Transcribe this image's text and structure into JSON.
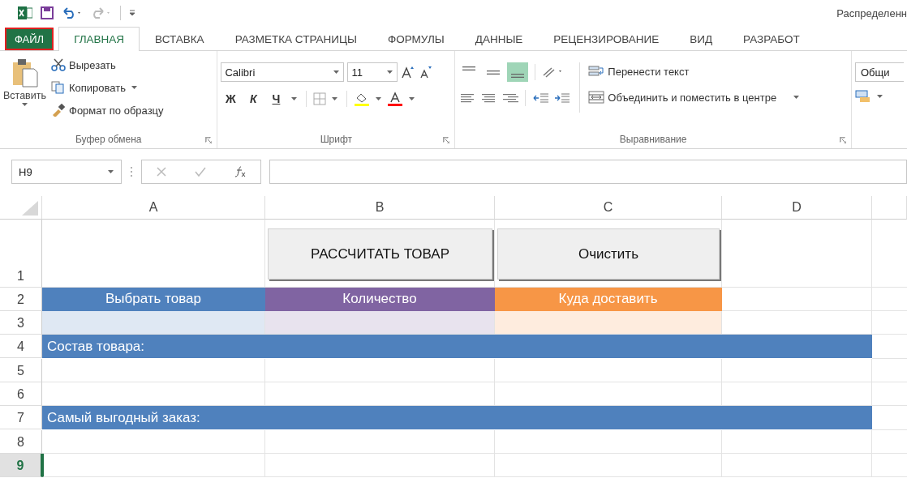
{
  "title_bar": {
    "title": "Распределенн"
  },
  "tabs": [
    {
      "label": "ФАЙЛ",
      "kind": "file",
      "selected": false
    },
    {
      "label": "ГЛАВНАЯ",
      "kind": "tab",
      "selected": true
    },
    {
      "label": "ВСТАВКА",
      "kind": "tab",
      "selected": false
    },
    {
      "label": "РАЗМЕТКА СТРАНИЦЫ",
      "kind": "tab",
      "selected": false
    },
    {
      "label": "ФОРМУЛЫ",
      "kind": "tab",
      "selected": false
    },
    {
      "label": "ДАННЫЕ",
      "kind": "tab",
      "selected": false
    },
    {
      "label": "РЕЦЕНЗИРОВАНИЕ",
      "kind": "tab",
      "selected": false
    },
    {
      "label": "ВИД",
      "kind": "tab",
      "selected": false
    },
    {
      "label": "РАЗРАБОТ",
      "kind": "tab",
      "selected": false
    }
  ],
  "clipboard": {
    "paste": "Вставить",
    "cut": "Вырезать",
    "copy": "Копировать",
    "format_painter": "Формат по образцу",
    "label": "Буфер обмена"
  },
  "font": {
    "font_name": "Calibri",
    "font_size": "11",
    "bold": "Ж",
    "italic": "К",
    "underline": "Ч",
    "label": "Шрифт"
  },
  "alignment": {
    "vertical": [
      {
        "selected": false
      },
      {
        "selected": false
      },
      {
        "selected": true
      }
    ],
    "wrap_text": "Перенести текст",
    "merge_center": "Объединить и поместить в центре",
    "label": "Выравнивание"
  },
  "number": {
    "format": "Общи"
  },
  "formula_bar": {
    "name_box": "H9"
  },
  "columns": [
    "A",
    "B",
    "C",
    "D"
  ],
  "rows": [
    {
      "number": "1",
      "selected": false,
      "kind": "buttons",
      "buttons": [
        "РАССЧИТАТЬ ТОВАР",
        "Очистить"
      ]
    },
    {
      "number": "2",
      "selected": false,
      "kind": "headers",
      "cells": [
        {
          "text": "Выбрать товар",
          "color": "#4f81bd"
        },
        {
          "text": "Количество",
          "color": "#8064a2"
        },
        {
          "text": "Куда доставить",
          "color": "#f79646"
        }
      ]
    },
    {
      "number": "3",
      "selected": false,
      "kind": "inputs"
    },
    {
      "number": "4",
      "selected": false,
      "kind": "band",
      "text": "Состав товара:"
    },
    {
      "number": "5",
      "selected": false,
      "kind": "empty"
    },
    {
      "number": "6",
      "selected": false,
      "kind": "empty"
    },
    {
      "number": "7",
      "selected": false,
      "kind": "band",
      "text": "Самый выгодный заказ:"
    },
    {
      "number": "8",
      "selected": false,
      "kind": "empty"
    },
    {
      "number": "9",
      "selected": true,
      "kind": "empty"
    }
  ]
}
